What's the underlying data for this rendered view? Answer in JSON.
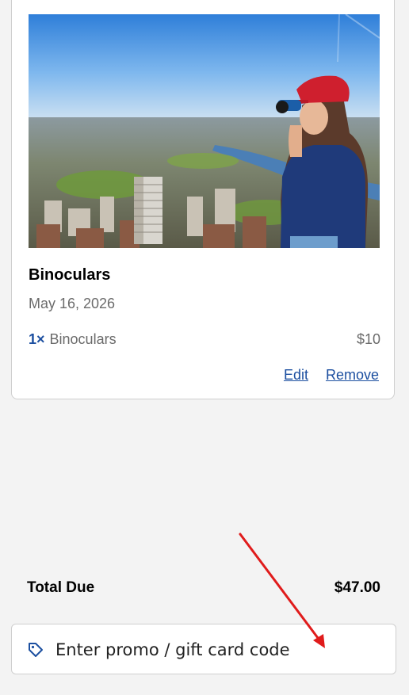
{
  "cart_item": {
    "title": "Binoculars",
    "date": "May 16, 2026",
    "line": {
      "quantity": "1×",
      "name": "Binoculars",
      "price": "$10"
    },
    "edit_label": "Edit",
    "remove_label": "Remove"
  },
  "total": {
    "label": "Total Due",
    "amount": "$47.00"
  },
  "promo": {
    "label": "Enter promo / gift card code",
    "icon": "tag-icon"
  },
  "colors": {
    "link": "#1c4fa0",
    "annotation_arrow": "#e01b1b",
    "background": "#f3f3f3"
  }
}
